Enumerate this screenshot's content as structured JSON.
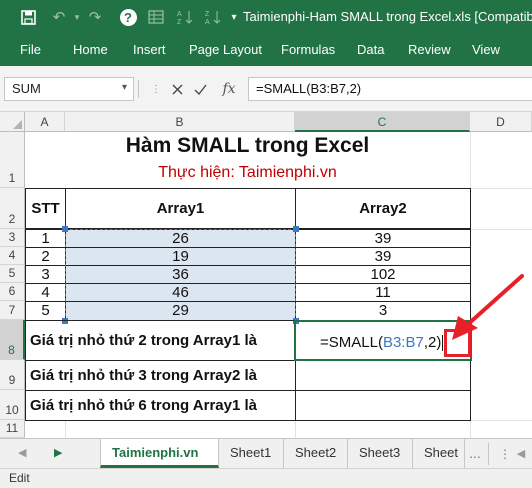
{
  "titlebar": {
    "title": "Taimienphi-Ham SMALL trong Excel.xls  [Compatibility"
  },
  "ribbon": {
    "tabs": [
      "File",
      "Home",
      "Insert",
      "Page Layout",
      "Formulas",
      "Data",
      "Review",
      "View"
    ]
  },
  "formula_bar": {
    "name_box": "SUM",
    "fx_label": "fx",
    "formula": "=SMALL(B3:B7,2)"
  },
  "grid": {
    "columns": [
      "A",
      "B",
      "C",
      "D"
    ],
    "rows": [
      "1",
      "2",
      "3",
      "4",
      "5",
      "6",
      "7",
      "8",
      "9",
      "10",
      "11"
    ],
    "title": "Hàm SMALL trong Excel",
    "subtitle": "Thực hiện: Taimienphi.vn",
    "headers": {
      "stt": "STT",
      "array1": "Array1",
      "array2": "Array2"
    },
    "data_rows": [
      {
        "stt": "1",
        "array1": "26",
        "array2": "39"
      },
      {
        "stt": "2",
        "array1": "19",
        "array2": "39"
      },
      {
        "stt": "3",
        "array1": "36",
        "array2": "102"
      },
      {
        "stt": "4",
        "array1": "46",
        "array2": "11"
      },
      {
        "stt": "5",
        "array1": "29",
        "array2": "3"
      }
    ],
    "questions": [
      "Giá trị nhỏ thứ 2 trong Array1 là",
      "Giá trị nhỏ thứ 3 trong Array2 là",
      "Giá trị nhỏ thứ 6 trong Array1 là"
    ],
    "editing_cell": {
      "prefix": "=SMALL(",
      "ref": "B3:B7",
      "suffix": ",2)"
    }
  },
  "sheet_tabs": {
    "tabs": [
      "Taimienphi.vn",
      "Sheet1",
      "Sheet2",
      "Sheet3",
      "Sheet"
    ],
    "more": "..."
  },
  "status": {
    "mode": "Edit"
  },
  "colors": {
    "accent": "#217346",
    "selection": "#dce6f1",
    "ref": "#3c78c8",
    "annotation": "#e8202a",
    "subtitle": "#c00000"
  }
}
